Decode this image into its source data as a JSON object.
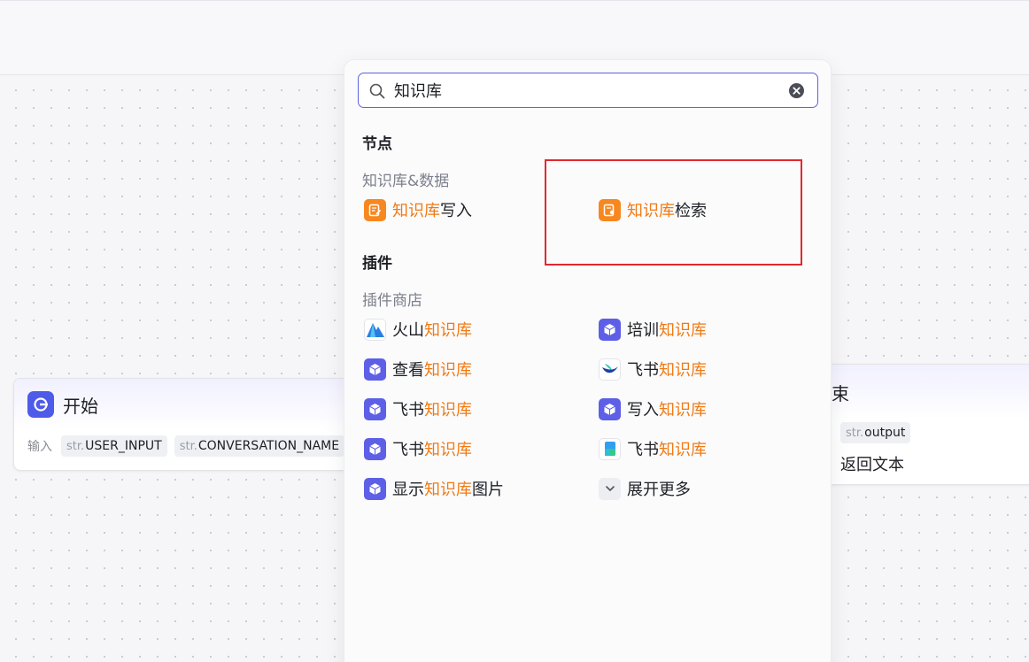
{
  "search": {
    "value": "知识库"
  },
  "sections": {
    "nodes": {
      "title": "节点",
      "category": "知识库&数据",
      "items": [
        {
          "highlight": "知识库",
          "suffix": "写入",
          "icon": "knowledge-write-icon"
        },
        {
          "highlight": "知识库",
          "suffix": "检索",
          "icon": "knowledge-search-icon"
        }
      ]
    },
    "plugins": {
      "title": "插件",
      "category": "插件商店",
      "items": [
        {
          "prefix": "火山",
          "highlight": "知识库",
          "suffix": "",
          "icon": "volcano-icon"
        },
        {
          "prefix": "培训",
          "highlight": "知识库",
          "suffix": "",
          "icon": "cube-icon"
        },
        {
          "prefix": "查看",
          "highlight": "知识库",
          "suffix": "",
          "icon": "cube-icon"
        },
        {
          "prefix": "飞书",
          "highlight": "知识库",
          "suffix": "",
          "icon": "feishu-icon"
        },
        {
          "prefix": "飞书",
          "highlight": "知识库",
          "suffix": "",
          "icon": "cube-icon"
        },
        {
          "prefix": "写入",
          "highlight": "知识库",
          "suffix": "",
          "icon": "cube-icon"
        },
        {
          "prefix": "飞书",
          "highlight": "知识库",
          "suffix": "",
          "icon": "cube-icon"
        },
        {
          "prefix": "飞书",
          "highlight": "知识库",
          "suffix": "",
          "icon": "doc-app-icon"
        },
        {
          "prefix": "显示",
          "highlight": "知识库",
          "suffix": "图片",
          "icon": "cube-icon"
        }
      ],
      "expand_label": "展开更多"
    }
  },
  "start_node": {
    "title": "开始",
    "input_label": "输入",
    "params": [
      {
        "type": "str.",
        "name": "USER_INPUT"
      },
      {
        "type": "str.",
        "name": "CONVERSATION_NAME"
      }
    ]
  },
  "end_node": {
    "title": "束",
    "param": {
      "type": "str.",
      "name": "output"
    },
    "text": "返回文本"
  },
  "colors": {
    "accent": "#5d62e0",
    "highlight": "#f07a14",
    "annotation": "#e0282e"
  }
}
